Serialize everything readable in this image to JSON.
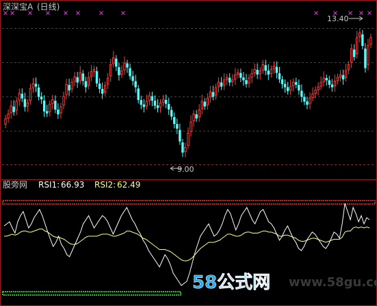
{
  "stock_name": "深深宝A",
  "period": "(日线)",
  "indicator_name": "股旁网",
  "rsi1_label": "RSI1:",
  "rsi1_value": "66.93",
  "rsi2_label": "RSI2:",
  "rsi2_value": "62.49",
  "price_high_label": "13.40",
  "price_low_label": "9.00",
  "marker_glyph": "×",
  "watermark_big": "58公式网",
  "watermark_url": "www.58gu.com",
  "colors": {
    "background": "#000000",
    "up_candle": "#FF3C3C",
    "down_candle": "#54FCFC",
    "grid": "#A01C1C",
    "rsi1": "#FFFFFF",
    "rsi2": "#FFFF80",
    "upper_band": "#FF3030",
    "lower_band": "#30FF30",
    "marker": "#FF40FF",
    "text": "#C8C8C8"
  },
  "chart_data": [
    {
      "type": "candlestick",
      "high_marker": 13.4,
      "low_marker": 9.0,
      "close": [
        10.4,
        10.55,
        10.8,
        10.62,
        10.95,
        11.2,
        11.05,
        10.78,
        10.9,
        11.35,
        11.5,
        11.42,
        11.1,
        11.02,
        10.64,
        10.58,
        10.86,
        11.0,
        10.7,
        10.55,
        10.78,
        11.1,
        11.48,
        11.3,
        11.55,
        11.72,
        11.55,
        11.85,
        11.6,
        11.4,
        11.7,
        11.88,
        11.95,
        11.52,
        11.35,
        11.2,
        11.45,
        11.68,
        12.1,
        12.32,
        12.05,
        11.78,
        11.9,
        12.15,
        12.02,
        11.75,
        11.6,
        11.4,
        11.0,
        10.85,
        10.78,
        10.95,
        11.12,
        10.98,
        10.82,
        10.75,
        10.9,
        11.0,
        10.88,
        10.7,
        10.48,
        10.25,
        10.1,
        9.7,
        9.35,
        9.5,
        9.95,
        10.3,
        10.55,
        10.42,
        10.68,
        10.95,
        10.8,
        11.05,
        11.25,
        11.1,
        11.38,
        11.55,
        11.42,
        11.62,
        11.7,
        11.55,
        11.62,
        11.78,
        11.85,
        11.7,
        11.62,
        11.5,
        11.68,
        11.82,
        11.95,
        11.8,
        11.9,
        12.1,
        11.92,
        11.8,
        11.95,
        12.05,
        11.85,
        11.65,
        11.5,
        11.4,
        11.28,
        11.42,
        11.55,
        11.48,
        11.3,
        11.1,
        10.95,
        10.85,
        11.05,
        11.18,
        11.3,
        11.4,
        11.55,
        11.68,
        11.62,
        11.48,
        11.4,
        11.58,
        11.7,
        11.78,
        11.65,
        11.92,
        12.1,
        12.6,
        12.35,
        12.95,
        13.1,
        12.7,
        12.0,
        12.7,
        12.95
      ]
    },
    {
      "type": "line",
      "series": [
        {
          "name": "RSI1",
          "values": [
            68,
            70,
            72,
            66,
            61,
            72,
            78,
            82,
            74,
            66,
            70,
            76,
            80,
            84,
            78,
            70,
            62,
            55,
            48,
            52,
            58,
            50,
            46,
            40,
            38,
            44,
            50,
            56,
            62,
            70,
            74,
            78,
            72,
            66,
            70,
            74,
            78,
            76,
            72,
            66,
            60,
            66,
            72,
            78,
            82,
            86,
            80,
            74,
            70,
            64,
            60,
            54,
            50,
            44,
            40,
            36,
            32,
            28,
            34,
            40,
            36,
            30,
            22,
            18,
            14,
            10,
            12,
            14,
            22,
            32,
            42,
            50,
            58,
            62,
            66,
            70,
            64,
            58,
            60,
            64,
            70,
            78,
            84,
            80,
            72,
            64,
            70,
            78,
            82,
            86,
            80,
            74,
            70,
            76,
            82,
            84,
            78,
            72,
            70,
            66,
            60,
            54,
            58,
            64,
            68,
            62,
            56,
            52,
            46,
            44,
            48,
            54,
            58,
            62,
            60,
            56,
            52,
            48,
            46,
            50,
            56,
            62,
            60,
            56,
            70,
            90,
            82,
            74,
            86,
            80,
            72,
            78,
            70,
            76,
            74
          ]
        },
        {
          "name": "RSI2",
          "values": [
            58,
            58,
            59,
            60,
            59,
            60,
            62,
            63,
            63,
            62,
            62,
            63,
            64,
            65,
            65,
            63,
            62,
            60,
            58,
            57,
            57,
            56,
            55,
            53,
            51,
            50,
            50,
            51,
            53,
            55,
            57,
            58,
            58,
            58,
            58,
            59,
            60,
            60,
            60,
            59,
            58,
            58,
            59,
            60,
            61,
            63,
            63,
            62,
            61,
            60,
            58,
            56,
            55,
            53,
            51,
            49,
            47,
            45,
            45,
            45,
            44,
            43,
            41,
            39,
            37,
            35,
            34,
            34,
            35,
            37,
            40,
            43,
            46,
            48,
            50,
            52,
            52,
            52,
            53,
            54,
            56,
            58,
            60,
            60,
            59,
            58,
            58,
            59,
            61,
            62,
            62,
            61,
            61,
            61,
            62,
            63,
            63,
            62,
            62,
            61,
            60,
            58,
            58,
            59,
            59,
            58,
            57,
            56,
            54,
            53,
            53,
            54,
            55,
            56,
            56,
            55,
            54,
            53,
            52,
            53,
            54,
            55,
            55,
            55,
            57,
            62,
            63,
            63,
            66,
            67,
            66,
            67,
            66,
            67,
            66
          ]
        }
      ],
      "upper_band": 80,
      "lower_band": 20,
      "ylim": [
        0,
        100
      ]
    }
  ]
}
